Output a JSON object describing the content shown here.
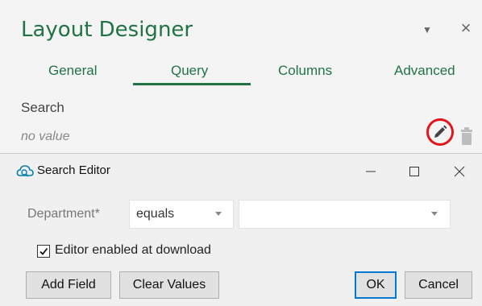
{
  "designer": {
    "title": "Layout Designer",
    "dropdown_icon": "chevron-down-icon",
    "close_icon": "close-icon",
    "tabs": [
      {
        "label": "General"
      },
      {
        "label": "Query",
        "active": true
      },
      {
        "label": "Columns"
      },
      {
        "label": "Advanced"
      }
    ],
    "search_label": "Search",
    "search_value": "no value",
    "edit_icon": "pencil-icon",
    "delete_icon": "trash-icon",
    "accent_color": "#217346",
    "highlight_color": "#e5141b"
  },
  "dialog": {
    "title": "Search Editor",
    "icon": "search-cloud-icon",
    "field_label": "Department*",
    "operator": "equals",
    "value": "",
    "editor_enabled_checked": true,
    "editor_enabled_label": "Editor enabled at download",
    "buttons": {
      "add_field": "Add Field",
      "clear_values": "Clear Values",
      "ok": "OK",
      "cancel": "Cancel"
    }
  }
}
